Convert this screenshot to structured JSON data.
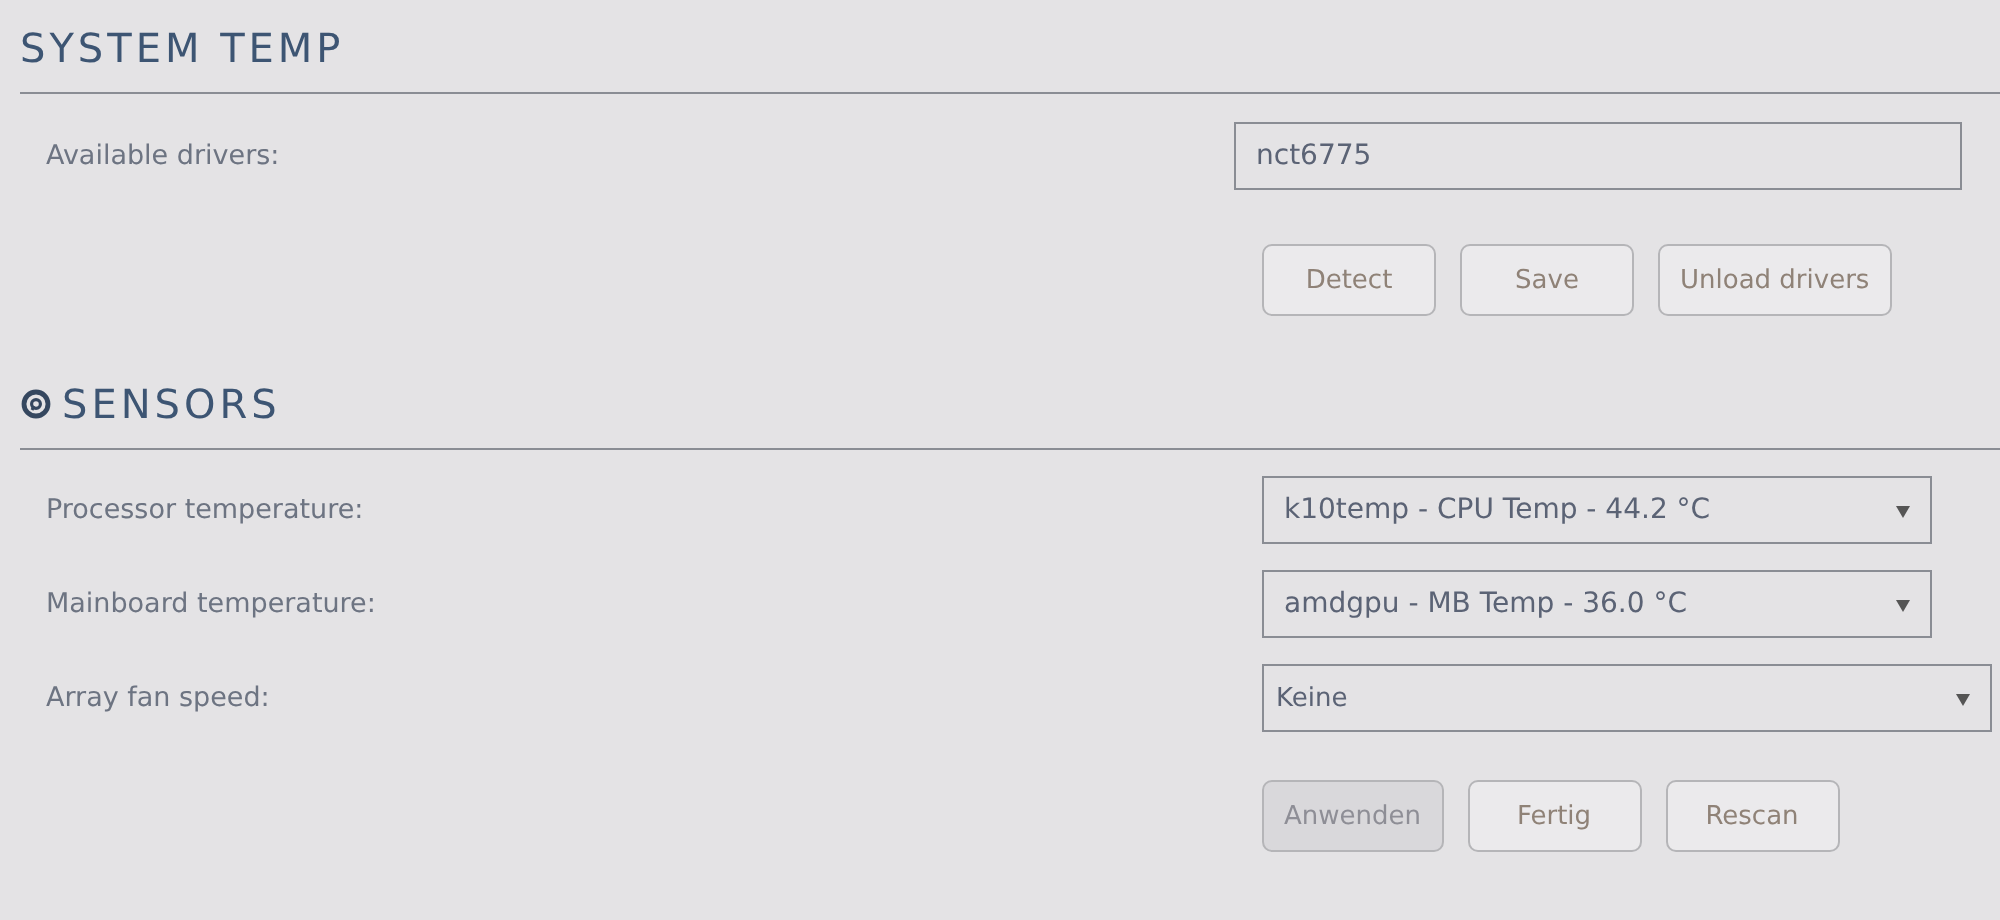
{
  "system_temp": {
    "title": "SYSTEM TEMP",
    "drivers_label": "Available drivers:",
    "drivers_value": "nct6775",
    "buttons": [
      {
        "label": "Detect",
        "disabled": false
      },
      {
        "label": "Save",
        "disabled": false
      },
      {
        "label": "Unload drivers",
        "disabled": false
      }
    ]
  },
  "sensors": {
    "title": "SENSORS",
    "rows": [
      {
        "label": "Processor temperature:",
        "value": "k10temp - CPU Temp - 44.2 °C"
      },
      {
        "label": "Mainboard temperature:",
        "value": "amdgpu - MB Temp - 36.0 °C"
      },
      {
        "label": "Array fan speed:",
        "value": "Keine"
      }
    ],
    "buttons": [
      {
        "label": "Anwenden",
        "disabled": true
      },
      {
        "label": "Fertig",
        "disabled": false
      },
      {
        "label": "Rescan",
        "disabled": false
      }
    ]
  }
}
